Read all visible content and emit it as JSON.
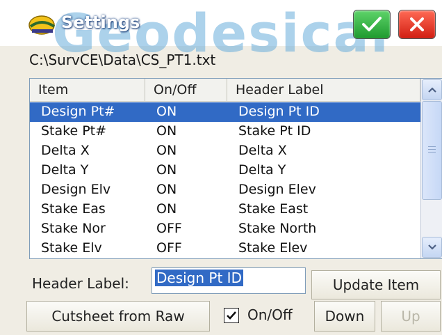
{
  "window": {
    "title": "Settings",
    "watermark": "Geodesical",
    "ok_icon": "checkmark-icon",
    "close_icon": "close-icon"
  },
  "file_path": "C:\\SurvCE\\Data\\CS_PT1.txt",
  "list": {
    "columns": [
      "Item",
      "On/Off",
      "Header Label"
    ],
    "rows": [
      {
        "item": "Design Pt#",
        "onoff": "ON",
        "label": "Design Pt ID",
        "selected": true
      },
      {
        "item": "Stake Pt#",
        "onoff": "ON",
        "label": "Stake Pt ID"
      },
      {
        "item": "Delta X",
        "onoff": "ON",
        "label": "Delta X"
      },
      {
        "item": "Delta Y",
        "onoff": "ON",
        "label": "Delta Y"
      },
      {
        "item": "Design Elv",
        "onoff": "ON",
        "label": "Design Elev"
      },
      {
        "item": "Stake Eas",
        "onoff": "ON",
        "label": "Stake East"
      },
      {
        "item": "Stake Nor",
        "onoff": "OFF",
        "label": "Stake North"
      },
      {
        "item": "Stake Elv",
        "onoff": "OFF",
        "label": "Stake Elev"
      }
    ]
  },
  "form": {
    "header_label_caption": "Header Label:",
    "header_label_value": "Design Pt ID",
    "update_button": "Update Item",
    "cutsheet_button": "Cutsheet from Raw",
    "onoff_checkbox_label": "On/Off",
    "onoff_checked": true,
    "down_button": "Down",
    "up_button": "Up"
  },
  "colors": {
    "selection": "#316ac5",
    "ok_button": "#2fb53c",
    "close_button": "#e2291b"
  }
}
